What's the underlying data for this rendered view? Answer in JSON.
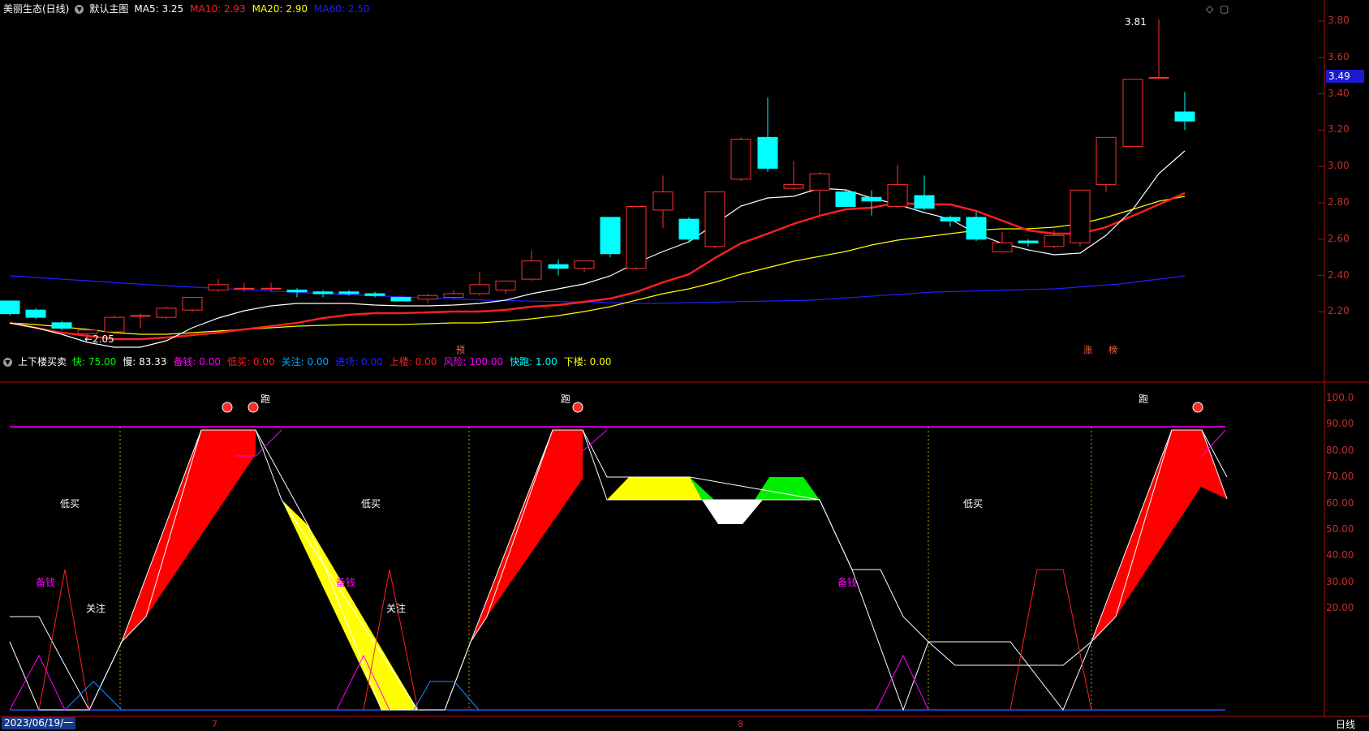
{
  "main_panel": {
    "title": "美丽生态(日线)",
    "menu_icon": "chevron-down-icon",
    "template": "默认主图",
    "indicators": [
      {
        "name": "MA5:",
        "value": "3.25",
        "color": "#ffffff"
      },
      {
        "name": "MA10:",
        "value": "2.93",
        "color": "#ff2020"
      },
      {
        "name": "MA20:",
        "value": "2.90",
        "color": "#ffff00"
      },
      {
        "name": "MA60:",
        "value": "2.50",
        "color": "#2020ff"
      }
    ],
    "y_axis": [
      "3.80",
      "3.60",
      "3.40",
      "3.20",
      "3.00",
      "2.80",
      "2.60",
      "2.40",
      "2.20"
    ],
    "current_price": "3.49",
    "high_label": "3.81",
    "low_label": "2.05",
    "markers": {
      "yu": "预",
      "zhang": "涨",
      "bang": "榜"
    }
  },
  "sub_panel": {
    "title": "上下楼买卖",
    "indicators": [
      {
        "name": "快:",
        "value": "75.00",
        "color": "#00ff00"
      },
      {
        "name": "慢:",
        "value": "83.33",
        "color": "#ffffff"
      },
      {
        "name": "备钱:",
        "value": "0.00",
        "color": "#ff00ff"
      },
      {
        "name": "低买:",
        "value": "0.00",
        "color": "#ff2020"
      },
      {
        "name": "关注:",
        "value": "0.00",
        "color": "#00aaff"
      },
      {
        "name": "进场:",
        "value": "0.00",
        "color": "#2020ff"
      },
      {
        "name": "上楼:",
        "value": "0.00",
        "color": "#ff2020"
      },
      {
        "name": "风险:",
        "value": "100.00",
        "color": "#ff00ff"
      },
      {
        "name": "快跑:",
        "value": "1.00",
        "color": "#00ffff"
      },
      {
        "name": "下楼:",
        "value": "0.00",
        "color": "#ffff00"
      }
    ],
    "y_axis": [
      "100.0",
      "90.00",
      "80.00",
      "70.00",
      "60.00",
      "50.00",
      "40.00",
      "30.00",
      "20.00"
    ],
    "labels": {
      "run": "跑",
      "low_buy": "低买",
      "ready_money": "备钱",
      "watch": "关注"
    }
  },
  "bottom_bar": {
    "date": "2023/06/19/一",
    "month_ticks": [
      "7",
      "8"
    ],
    "period": "日线"
  },
  "colors": {
    "up": "#ff3030",
    "down": "#00ffff",
    "axis": "#b01010"
  }
}
